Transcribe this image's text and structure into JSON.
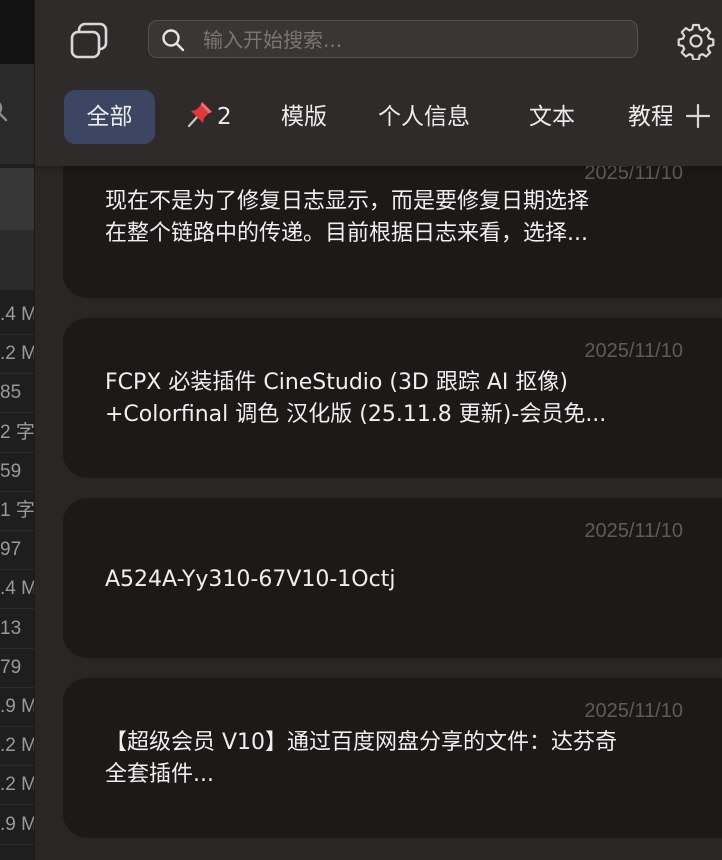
{
  "background_window": {
    "cells": [
      ".4 M",
      ".2 M",
      "85",
      "2 字",
      "59",
      "1 字",
      "97",
      ".4 M",
      "13",
      "79",
      ".9 M",
      ".2 M",
      ".2 M",
      ".9 M"
    ]
  },
  "header": {
    "search": {
      "placeholder": "输入开始搜索...",
      "value": ""
    },
    "tabs": [
      {
        "label": "全部",
        "active": true
      },
      {
        "label": "2",
        "icon": "pushpin-icon",
        "active": false
      },
      {
        "label": "模版",
        "active": false
      },
      {
        "label": "个人信息",
        "active": false
      },
      {
        "label": "文本",
        "active": false
      },
      {
        "label": "教程",
        "active": false
      }
    ]
  },
  "clips": [
    {
      "date": "2025/11/10",
      "text": "现在不是为了修复日志显示，而是要修复日期选择\n在整个链路中的传递。目前根据日志来看，选择..."
    },
    {
      "date": "2025/11/10",
      "text": "FCPX 必装插件 CineStudio (3D 跟踪 AI 抠像)\n+Colorfinal 调色 汉化版 (25.11.8 更新)-会员免..."
    },
    {
      "date": "2025/11/10",
      "text": "A524A-Yy310-67V10-1Octj"
    },
    {
      "date": "2025/11/10",
      "text": "【超级会员 V10】通过百度网盘分享的文件：达芬奇\n全套插件..."
    }
  ],
  "colors": {
    "panel_bg": "#2a2625",
    "card_bg": "#1b1a19",
    "active_tab": "#3c4662",
    "date_text": "#5e5b5a"
  }
}
